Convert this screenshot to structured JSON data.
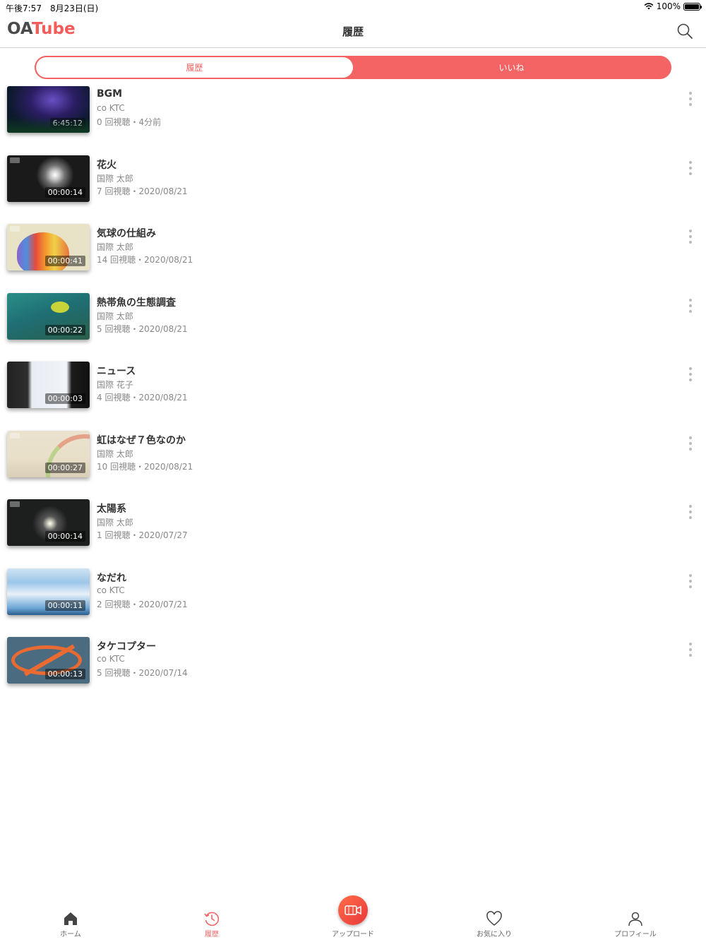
{
  "status_bar": {
    "time": "午後7:57　8月23日(日)",
    "battery": "100%"
  },
  "header": {
    "logo_oa": "OA",
    "logo_tube": "Tube",
    "title": "履歴"
  },
  "segment": {
    "tabs": [
      {
        "label": "履歴"
      },
      {
        "label": "いいね"
      }
    ],
    "selected": "履歴"
  },
  "videos": [
    {
      "title": "BGM",
      "channel": "co KTC",
      "meta": "0 回視聴・4分前",
      "duration": "6:45:12",
      "thumb": "night-forest"
    },
    {
      "title": "花火",
      "channel": "国際 太郎",
      "meta": "7 回視聴・2020/08/21",
      "duration": "00:00:14",
      "thumb": "fireworks"
    },
    {
      "title": "気球の仕組み",
      "channel": "国際 太郎",
      "meta": "14 回視聴・2020/08/21",
      "duration": "00:00:41",
      "thumb": "balloon"
    },
    {
      "title": "熱帯魚の生態調査",
      "channel": "国際 太郎",
      "meta": "5 回視聴・2020/08/21",
      "duration": "00:00:22",
      "thumb": "tropical-fish"
    },
    {
      "title": "ニュース",
      "channel": "国際 花子",
      "meta": "4 回視聴・2020/08/21",
      "duration": "00:00:03",
      "thumb": "news"
    },
    {
      "title": "虹はなぜ７色なのか",
      "channel": "国際 太郎",
      "meta": "10 回視聴・2020/08/21",
      "duration": "00:00:27",
      "thumb": "rainbow"
    },
    {
      "title": "太陽系",
      "channel": "国際 太郎",
      "meta": "1 回視聴・2020/07/27",
      "duration": "00:00:14",
      "thumb": "sun"
    },
    {
      "title": "なだれ",
      "channel": "co KTC",
      "meta": "2 回視聴・2020/07/21",
      "duration": "00:00:11",
      "thumb": "glacier"
    },
    {
      "title": "タケコプター",
      "channel": "co KTC",
      "meta": "5 回視聴・2020/07/14",
      "duration": "00:00:13",
      "thumb": "copter"
    }
  ],
  "tab_bar": {
    "items": [
      {
        "label": "ホーム",
        "icon": "home-icon"
      },
      {
        "label": "履歴",
        "icon": "history-icon"
      },
      {
        "label": "アップロード",
        "icon": "video-camera-icon"
      },
      {
        "label": "お気に入り",
        "icon": "heart-icon"
      },
      {
        "label": "プロフィール",
        "icon": "person-icon"
      }
    ],
    "active": "履歴"
  },
  "colors": {
    "accent": "#f46464",
    "text": "#333333",
    "muted": "#888888"
  }
}
